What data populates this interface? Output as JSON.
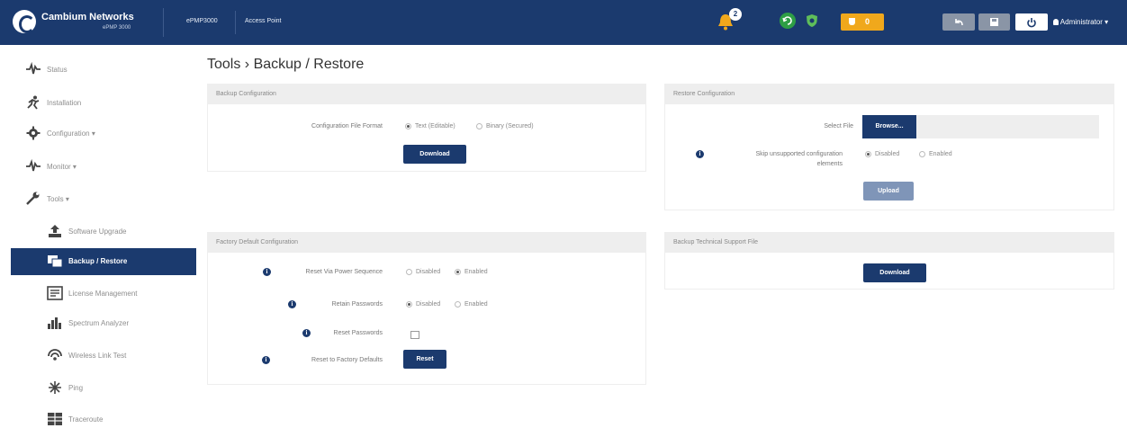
{
  "header": {
    "brand_name": "Cambium Networks",
    "brand_sub": "ePMP 3000",
    "device_model": "ePMP3000",
    "device_mode": "Access Point",
    "alarm_count": "2",
    "status_count": "0",
    "user": "Administrator",
    "colors": {
      "bar": "#1b3a6e",
      "warning": "#f0a81c",
      "ok": "#2e9e45",
      "refresh": "#5fbe5a",
      "disabled_button": "#7f95b8"
    }
  },
  "sidebar": {
    "items": [
      {
        "label": "Status",
        "icon": "pulse-icon"
      },
      {
        "label": "Installation",
        "icon": "runner-icon"
      },
      {
        "label": "Configuration",
        "icon": "gear-icon"
      },
      {
        "label": "Monitor",
        "icon": "pulse-icon"
      },
      {
        "label": "Tools",
        "icon": "wrench-icon"
      },
      {
        "label": "Software Upgrade",
        "icon": "upload-icon"
      },
      {
        "label": "Backup / Restore",
        "icon": "backup-icon",
        "active": true
      },
      {
        "label": "License Management",
        "icon": "license-icon"
      },
      {
        "label": "Spectrum Analyzer",
        "icon": "bars-icon"
      },
      {
        "label": "Wireless Link Test",
        "icon": "wifi-icon"
      },
      {
        "label": "Ping",
        "icon": "ping-icon"
      },
      {
        "label": "Traceroute",
        "icon": "traceroute-icon"
      }
    ]
  },
  "page": {
    "title": "Tools › Backup / Restore"
  },
  "backup": {
    "title": "Backup Configuration",
    "format_label": "Configuration File Format",
    "option_text": "Text (Editable)",
    "option_binary": "Binary (Secured)",
    "selected": "text",
    "download_label": "Download"
  },
  "restore": {
    "title": "Restore Configuration",
    "select_file_label": "Select File",
    "browse_label": "Browse...",
    "skip_label_line1": "Skip unsupported configuration",
    "skip_label_line2": "elements",
    "option_disabled": "Disabled",
    "option_enabled": "Enabled",
    "selected": "disabled",
    "upload_label": "Upload"
  },
  "factory": {
    "title": "Factory Default Configuration",
    "reset_power_label": "Reset Via Power Sequence",
    "reset_power_selected": "enabled",
    "retain_passwords_label": "Retain Passwords",
    "retain_passwords_selected": "disabled",
    "reset_passwords_label": "Reset Passwords",
    "reset_defaults_label": "Reset to Factory Defaults",
    "option_disabled": "Disabled",
    "option_enabled": "Enabled",
    "reset_button": "Reset"
  },
  "support": {
    "title": "Backup Technical Support File",
    "download_label": "Download"
  }
}
